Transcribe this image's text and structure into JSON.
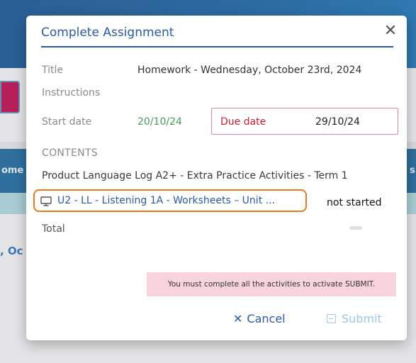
{
  "background": {
    "fragment_left": "ome",
    "fragment_right": "s",
    "fragment_blue": ", Oc"
  },
  "modal": {
    "title": "Complete Assignment",
    "close_symbol": "✕",
    "fields": {
      "title_label": "Title",
      "title_value": "Homework - Wednesday, October 23rd, 2024",
      "instructions_label": "Instructions",
      "start_label": "Start date",
      "start_value": "20/10/24",
      "due_label": "Due date",
      "due_value": "29/10/24"
    },
    "contents": {
      "label": "CONTENTS",
      "product_title": "Product Language Log A2+ - Extra Practice Activities - Term 1",
      "activity": {
        "icon": "monitor-icon",
        "label": "U2 - LL - Listening 1A - Worksheets – Unit ...",
        "status": "not started"
      },
      "total_label": "Total"
    },
    "notice": "You must complete all the activities to activate SUBMIT.",
    "buttons": {
      "cancel_icon": "✕",
      "cancel_label": "Cancel",
      "submit_label": "Submit"
    }
  },
  "colors": {
    "accent": "#2a5aa6",
    "due": "#c8202e",
    "start": "#4a9c5a",
    "highlight": "#ec7a1c",
    "notice_bg": "#fad4dc",
    "submit_disabled": "#9fc6e4"
  }
}
